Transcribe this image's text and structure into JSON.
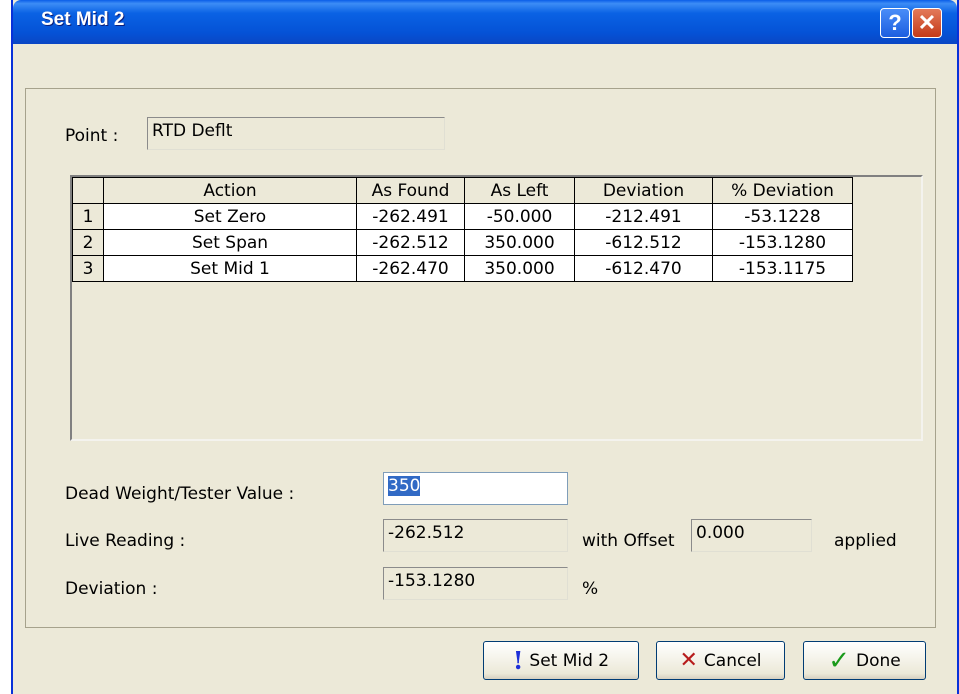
{
  "window": {
    "title": "Set Mid 2",
    "help_glyph": "?",
    "close_glyph": "✕"
  },
  "point": {
    "label": "Point :",
    "value": "RTD Deflt"
  },
  "table": {
    "headers": [
      "",
      "Action",
      "As Found",
      "As Left",
      "Deviation",
      "% Deviation"
    ],
    "rows": [
      [
        "1",
        "Set Zero",
        "-262.491",
        "-50.000",
        "-212.491",
        "-53.1228"
      ],
      [
        "2",
        "Set Span",
        "-262.512",
        "350.000",
        "-612.512",
        "-153.1280"
      ],
      [
        "3",
        "Set Mid 1",
        "-262.470",
        "350.000",
        "-612.470",
        "-153.1175"
      ]
    ]
  },
  "dead_weight": {
    "label": "Dead Weight/Tester Value :",
    "value": "350"
  },
  "live_reading": {
    "label": "Live Reading :",
    "value": "-262.512",
    "offset_label": "with Offset",
    "offset_value": "0.000",
    "applied_label": "applied"
  },
  "deviation": {
    "label": "Deviation :",
    "value": "-153.1280",
    "unit": "%"
  },
  "buttons": {
    "set_mid2": "Set Mid 2",
    "cancel": "Cancel",
    "done": "Done"
  },
  "icons": {
    "set_mid2": "exclamation-icon",
    "cancel": "x-icon",
    "done": "checkmark-icon"
  },
  "colors": {
    "title_bar": "#0a5de8",
    "dialog_bg": "#ece9d8",
    "selection": "#316ac5"
  }
}
